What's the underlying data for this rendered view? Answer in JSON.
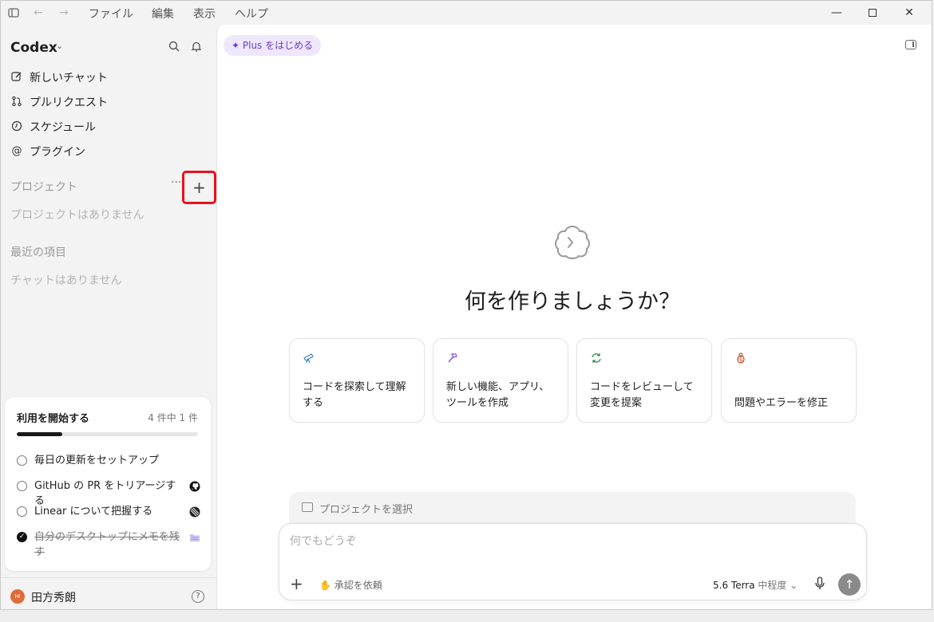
{
  "titlebar": {
    "menus": [
      "ファイル",
      "編集",
      "表示",
      "ヘルプ"
    ]
  },
  "sidebar": {
    "brand": "Codex",
    "nav": [
      {
        "label": "新しいチャット",
        "icon": "edit-icon"
      },
      {
        "label": "プルリクエスト",
        "icon": "pull-request-icon"
      },
      {
        "label": "スケジュール",
        "icon": "clock-icon"
      },
      {
        "label": "プラグイン",
        "icon": "at-icon"
      }
    ],
    "projects_title": "プロジェクト",
    "projects_empty": "プロジェクトはありません",
    "recent_title": "最近の項目",
    "recent_empty": "チャットはありません"
  },
  "getting_started": {
    "title": "利用を開始する",
    "count": "4 件中 1 件",
    "progress": 0.25,
    "items": [
      {
        "label": "毎日の更新をセットアップ",
        "done": false
      },
      {
        "label": "GitHub の PR をトリアージする",
        "done": false,
        "icon": "github-icon"
      },
      {
        "label": "Linear について把握する",
        "done": false,
        "icon": "linear-icon"
      },
      {
        "label": "自分のデスクトップにメモを残す",
        "done": true,
        "icon": "folder-icon"
      }
    ]
  },
  "user": {
    "name": "田方秀朗",
    "avatar_initials": "HI"
  },
  "main": {
    "plus_label": "✦ Plus をはじめる",
    "headline": "何を作りましょうか？",
    "suggestions": [
      {
        "label": "コードを探索して理解する",
        "icon": "telescope-icon",
        "color": "#3b82c4"
      },
      {
        "label": "新しい機能、アプリ、ツールを作成",
        "icon": "hammer-icon",
        "color": "#8a4bd6"
      },
      {
        "label": "コードをレビューして変更を提案",
        "icon": "refresh-icon",
        "color": "#2f8a4f"
      },
      {
        "label": "問題やエラーを修正",
        "icon": "bug-icon",
        "color": "#c6542d"
      }
    ],
    "project_select": "プロジェクトを選択",
    "composer": {
      "placeholder": "何でもどうぞ",
      "approval": "承認を依頼",
      "model": "5.6 Terra",
      "effort": "中程度"
    }
  }
}
